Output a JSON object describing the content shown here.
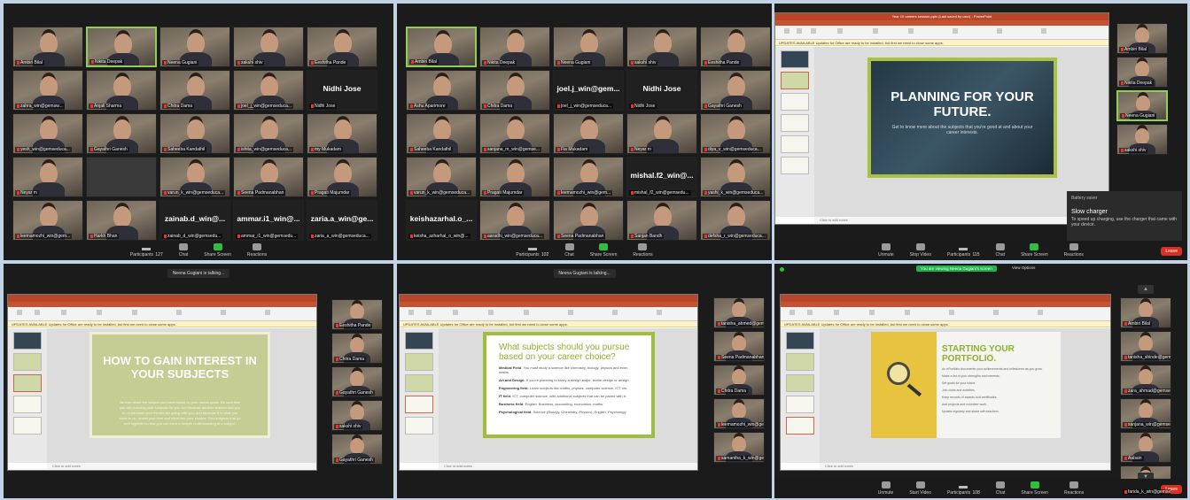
{
  "panel1": {
    "tiles": [
      {
        "label": "Ambiri Bilal",
        "cam": true
      },
      {
        "label": "Nikita Deepak",
        "cam": true,
        "speaking": true
      },
      {
        "label": "Neena Gugiani",
        "cam": true
      },
      {
        "label": "sakshi shiv",
        "cam": true
      },
      {
        "label": "Eeshitha Pande",
        "cam": true
      },
      {
        "label": "zahra_win@gemsw...",
        "cam": true
      },
      {
        "label": "Anjali Sharma",
        "cam": true
      },
      {
        "label": "Chitra Dama",
        "cam": true
      },
      {
        "label": "joel_j_win@gemseduca...",
        "cam": true
      },
      {
        "label": "Nidhi Jose",
        "big": "Nidhi Jose"
      },
      {
        "label": "yesh_win@gemseduca...",
        "cam": true
      },
      {
        "label": "Gayathri Ganesh",
        "cam": true
      },
      {
        "label": "Saheeba Kandathil",
        "cam": true
      },
      {
        "label": "ishita_win@gemseduca...",
        "cam": true
      },
      {
        "label": "my Mukadam",
        "cam": true
      },
      {
        "label": "Neyar m",
        "cam": true
      },
      {
        "label": "",
        "cam": false
      },
      {
        "label": "varun_k_win@gemseduca...",
        "cam": true
      },
      {
        "label": "Seena Padmanabhan",
        "cam": true
      },
      {
        "label": "Pragati Majumdar",
        "cam": true
      },
      {
        "label": "leemamozhi_win@gem...",
        "cam": true
      },
      {
        "label": "Harkh Bhan",
        "cam": true
      },
      {
        "label": "zainab_d_win@gemsedu...",
        "big": "zainab.d_win@..."
      },
      {
        "label": "ammar_i1_win@gemsedu...",
        "big": "ammar.i1_win@..."
      },
      {
        "label": "zaria_a_win@gemseduca...",
        "big": "zaria.a_win@ge..."
      }
    ],
    "toolbar": {
      "participants_count": "127",
      "participants": "Participants",
      "chat": "Chat",
      "share": "Share Screen",
      "reactions": "Reactions"
    }
  },
  "panel2": {
    "tiles": [
      {
        "label": "Ambiri Bilal",
        "cam": true,
        "speaking": true
      },
      {
        "label": "Nikita Deepak",
        "cam": true
      },
      {
        "label": "Neena Gugiani",
        "cam": true
      },
      {
        "label": "sakshi shiv",
        "cam": true
      },
      {
        "label": "Eeshitha Pande",
        "cam": true
      },
      {
        "label": "Ashu Aparimore",
        "cam": true
      },
      {
        "label": "Chitra Dama",
        "cam": true
      },
      {
        "label": "joel_j_win@gemseduca...",
        "big": "joel.j_win@gem..."
      },
      {
        "label": "Nidhi Jose",
        "big": "Nidhi Jose"
      },
      {
        "label": "Gayathri Ganesh",
        "cam": true
      },
      {
        "label": "Saheeba Kandathil",
        "cam": true
      },
      {
        "label": "sanjana_m_win@gemse...",
        "cam": true
      },
      {
        "label": "Fia Mukadam",
        "cam": true
      },
      {
        "label": "Neyar m",
        "cam": true
      },
      {
        "label": "diya_v_win@gemseduca...",
        "cam": true
      },
      {
        "label": "varun_k_win@gemseduca...",
        "cam": true
      },
      {
        "label": "Pragati Majumdar",
        "cam": true
      },
      {
        "label": "leemamozhi_win@gem...",
        "cam": true
      },
      {
        "label": "mishal_f2_win@gemsedu...",
        "big": "mishal.f2_win@..."
      },
      {
        "label": "yashi_k_win@gemseduca...",
        "cam": true
      },
      {
        "label": "keisha_azharhal_o_win@...",
        "big": "keishazarhal.o_..."
      },
      {
        "label": "aaradhi_win@gemseduca...",
        "cam": true
      },
      {
        "label": "Seena Padmanabhan",
        "cam": true
      },
      {
        "label": "Sanjan Bandh",
        "cam": true
      },
      {
        "label": "defsha_r_win@gemseduca...",
        "cam": true
      }
    ],
    "toolbar": {
      "participants_count": "102",
      "participants": "Participants",
      "chat": "Chat",
      "share": "Share Screen",
      "reactions": "Reactions"
    }
  },
  "panel3": {
    "ppt_title": "Year 10 careers session.pptx (Last saved by user) - PowerPoint",
    "update_bar": "UPDATES AVAILABLE   Updates for Office are ready to be installed, but first we need to close some apps.",
    "slide_title": "PLANNING FOR YOUR FUTURE.",
    "slide_sub": "Get to know more about the subjects that you're good at and about your career interests.",
    "notes": "Click to add notes",
    "strip": [
      {
        "label": "Ambiri Bilal"
      },
      {
        "label": "Nikita Deepak"
      },
      {
        "label": "Neena Gugiani",
        "speaking": true
      },
      {
        "label": "sakshi shiv"
      }
    ],
    "battery_head": "Battery saver",
    "battery_title": "Slow charger",
    "battery_body": "To speed up charging, use the charger that came with your device.",
    "toolbar": {
      "unmute": "Unmute",
      "stop_video": "Stop Video",
      "participants_count": "115",
      "participants": "Participants",
      "chat": "Chat",
      "share": "Share Screen",
      "reactions": "Reactions",
      "leave": "Leave"
    }
  },
  "panel4": {
    "talking": "Neena Gugiani is talking...",
    "slide_title": "HOW TO GAIN INTEREST IN YOUR SUBJECTS",
    "slide_body": "Be true about the subject you have based on your career goals. Be sure that you are pursuing your subjects for you, not because another teacher told you to, or because your friends are going with you, and because it is what you know to do. Invest your time and effort into your studies. Find subjects that go well together so that you can have a deeper understanding of a subject.",
    "notes": "Click to add notes",
    "strip": [
      {
        "label": "Eeshitha Pande"
      },
      {
        "label": "Chitra Dama"
      },
      {
        "label": "Gayathri Ganesh"
      },
      {
        "label": "sakshi shiv"
      },
      {
        "label": "Gayathri Ganesh"
      }
    ]
  },
  "panel5": {
    "talking": "Neena Gugiani is talking...",
    "slide_title": "What subjects should you pursue based on your career choice?",
    "bullets": [
      {
        "head": "Medical Field",
        "text": "- You must study a science like chemistry, biology, physics and even maths."
      },
      {
        "head": "Art and Design",
        "text": "- If you're planning to study a design major, textile design or design."
      },
      {
        "head": "Engineering field",
        "text": "- Learn subjects like maths, physics, computer science, ICT etc."
      },
      {
        "head": "IT field",
        "text": "- ICT, computer science, with additional subjects that can be paired with it."
      },
      {
        "head": "Business field",
        "text": "- English, Business, accounting, economics, maths."
      },
      {
        "head": "Psychological field",
        "text": "- Science (Biology, Chemistry, Physics), English, Psychology."
      }
    ],
    "notes": "Click to add notes",
    "strip": [
      {
        "label": "tanisha_ahmed@gemsed..."
      },
      {
        "label": "Seena Padmanabhan"
      },
      {
        "label": "Chitra Dama"
      },
      {
        "label": "leemamozhi_win@gem..."
      },
      {
        "label": "samantha_k_win@gems..."
      }
    ]
  },
  "panel6": {
    "share_banner": "You are viewing Neena Gugiani's screen",
    "view_options": "View Options",
    "slide_title": "STARTING YOUR PORTFOLIO.",
    "bullets": [
      "An ePortfolio documents your achievements and milestones as you grow.",
      "Make a list of your strengths and interests.",
      "Set goals for your future.",
      "Join clubs and activities.",
      "Keep records of awards and certificates.",
      "Add projects and volunteer work.",
      "Update regularly and share with teachers."
    ],
    "notes": "Click to add notes",
    "strip": [
      {
        "label": "Ambiri Bilal"
      },
      {
        "label": "tanisha_shinde@gemse..."
      },
      {
        "label": "zara_ahmad@gemseduca..."
      },
      {
        "label": "sanjana_win@gemsedu..."
      },
      {
        "label": "Aabain"
      },
      {
        "label": "farida_k_win@gemseduca..."
      }
    ],
    "toolbar": {
      "unmute": "Unmute",
      "stop_video": "Start Video",
      "participants_count": "108",
      "participants": "Participants",
      "chat": "Chat",
      "share": "Share Screen",
      "reactions": "Reactions",
      "leave": "Leave"
    }
  }
}
